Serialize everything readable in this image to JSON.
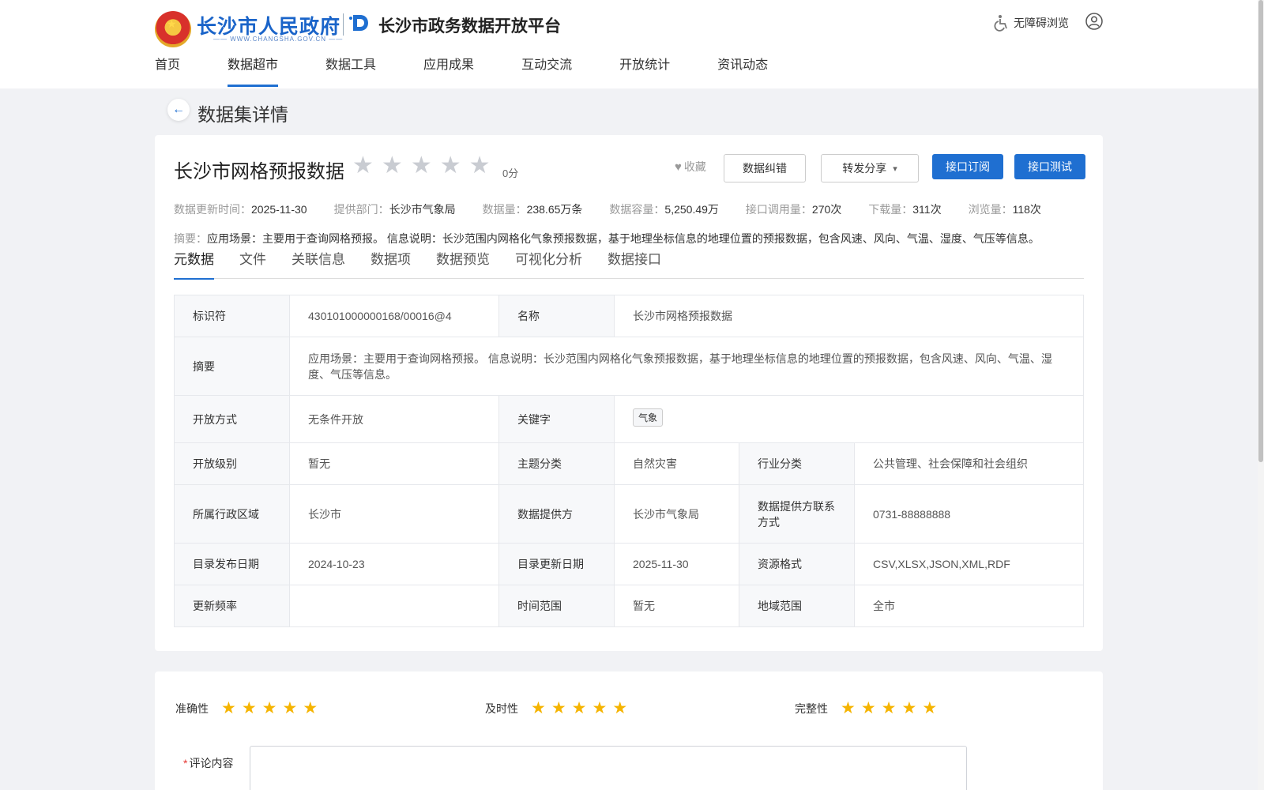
{
  "header": {
    "gov_title": "长沙市人民政府",
    "gov_url": "—— WWW.CHANGSHA.GOV.CN ——",
    "platform_name": "长沙市政务数据开放平台",
    "accessibility": "无障碍浏览"
  },
  "nav": [
    {
      "label": "首页",
      "active": false
    },
    {
      "label": "数据超市",
      "active": true
    },
    {
      "label": "数据工具",
      "active": false
    },
    {
      "label": "应用成果",
      "active": false
    },
    {
      "label": "互动交流",
      "active": false
    },
    {
      "label": "开放统计",
      "active": false
    },
    {
      "label": "资讯动态",
      "active": false
    }
  ],
  "page_title": "数据集详情",
  "dataset": {
    "title": "长沙市网格预报数据",
    "score": "0分",
    "rating_value": 0,
    "rating_max": 5,
    "favorite": "收藏",
    "btn_correct": "数据纠错",
    "btn_share": "转发分享",
    "btn_subscribe": "接口订阅",
    "btn_test": "接口测试",
    "meta": [
      {
        "label": "数据更新时间：",
        "value": "2025-11-30"
      },
      {
        "label": "提供部门：",
        "value": "长沙市气象局"
      },
      {
        "label": "数据量：",
        "value": "238.65万条"
      },
      {
        "label": "数据容量：",
        "value": "5,250.49万"
      },
      {
        "label": "接口调用量：",
        "value": "270次"
      },
      {
        "label": "下载量：",
        "value": "311次"
      },
      {
        "label": "浏览量：",
        "value": "118次"
      }
    ],
    "summary_label": "摘要：",
    "summary": "应用场景：主要用于查询网格预报。 信息说明：长沙范围内网格化气象预报数据，基于地理坐标信息的地理位置的预报数据，包含风速、风向、气温、湿度、气压等信息。"
  },
  "tabs": [
    {
      "label": "元数据",
      "active": true
    },
    {
      "label": "文件",
      "active": false
    },
    {
      "label": "关联信息",
      "active": false
    },
    {
      "label": "数据项",
      "active": false
    },
    {
      "label": "数据预览",
      "active": false
    },
    {
      "label": "可视化分析",
      "active": false
    },
    {
      "label": "数据接口",
      "active": false
    }
  ],
  "metadata": {
    "id_k": "标识符",
    "id_v": "430101000000168/00016@4",
    "name_k": "名称",
    "name_v": "长沙市网格预报数据",
    "summary_k": "摘要",
    "summary_v": "应用场景：主要用于查询网格预报。 信息说明：长沙范围内网格化气象预报数据，基于地理坐标信息的地理位置的预报数据，包含风速、风向、气温、湿度、气压等信息。",
    "open_mode_k": "开放方式",
    "open_mode_v": "无条件开放",
    "keywords_k": "关键字",
    "keyword_tag": "气象",
    "open_level_k": "开放级别",
    "open_level_v": "暂无",
    "theme_k": "主题分类",
    "theme_v": "自然灾害",
    "industry_k": "行业分类",
    "industry_v": "公共管理、社会保障和社会组织",
    "region_k": "所属行政区域",
    "region_v": "长沙市",
    "provider_k": "数据提供方",
    "provider_v": "长沙市气象局",
    "contact_k": "数据提供方联系方式",
    "contact_v": "0731-88888888",
    "pub_date_k": "目录发布日期",
    "pub_date_v": "2024-10-23",
    "upd_date_k": "目录更新日期",
    "upd_date_v": "2025-11-30",
    "format_k": "资源格式",
    "format_v": "CSV,XLSX,JSON,XML,RDF",
    "freq_k": "更新频率",
    "freq_v": "",
    "time_range_k": "时间范围",
    "time_range_v": "暂无",
    "geo_range_k": "地域范围",
    "geo_range_v": "全市"
  },
  "review": {
    "accuracy_label": "准确性",
    "accuracy_stars": 5,
    "timeliness_label": "及时性",
    "timeliness_stars": 5,
    "completeness_label": "完整性",
    "completeness_stars": 5,
    "comment_label": "评论内容",
    "required_mark": "*"
  },
  "colors": {
    "primary": "#1f6fd1",
    "star_active": "#f5b400",
    "star_inactive": "#c9ccd2"
  }
}
